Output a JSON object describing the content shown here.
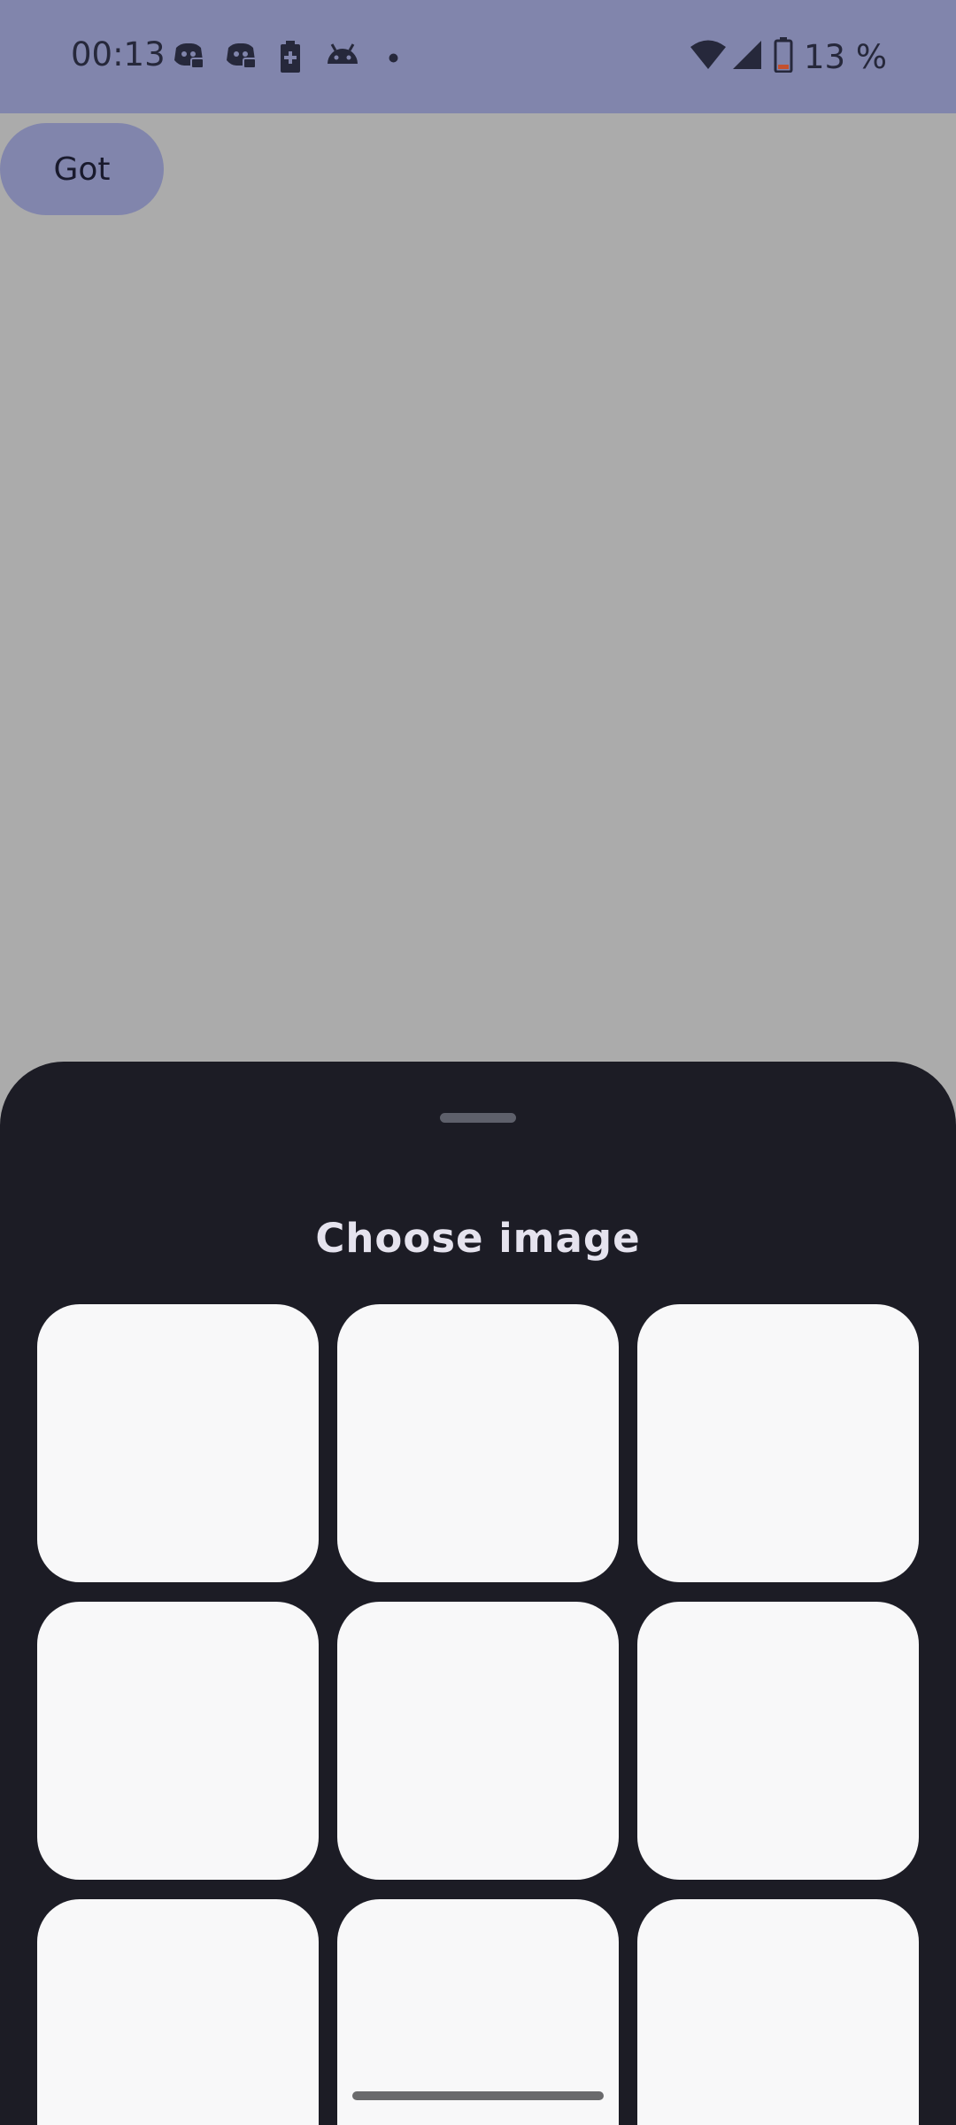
{
  "status_bar": {
    "time": "00:13",
    "notification_icons": [
      "discord-icon",
      "discord-icon",
      "battery-saver-icon",
      "android-icon",
      "more-dot-icon"
    ],
    "battery_text": "13 %",
    "system_icons": [
      "wifi-icon",
      "cellular-signal-icon",
      "battery-low-icon"
    ]
  },
  "main": {
    "button_label": "Got"
  },
  "sheet": {
    "title": "Choose image",
    "tiles": [
      {
        "name": "image-tile-1"
      },
      {
        "name": "image-tile-2"
      },
      {
        "name": "image-tile-3"
      },
      {
        "name": "image-tile-4"
      },
      {
        "name": "image-tile-5"
      },
      {
        "name": "image-tile-6"
      },
      {
        "name": "image-tile-7"
      },
      {
        "name": "image-tile-8"
      },
      {
        "name": "image-tile-9"
      }
    ]
  },
  "colors": {
    "status_bar_bg": "#8185ac",
    "scrim": "#ababab",
    "sheet_bg": "#1c1c25",
    "tile_bg": "#f8f8f9",
    "title_text": "#e5e3ee"
  }
}
